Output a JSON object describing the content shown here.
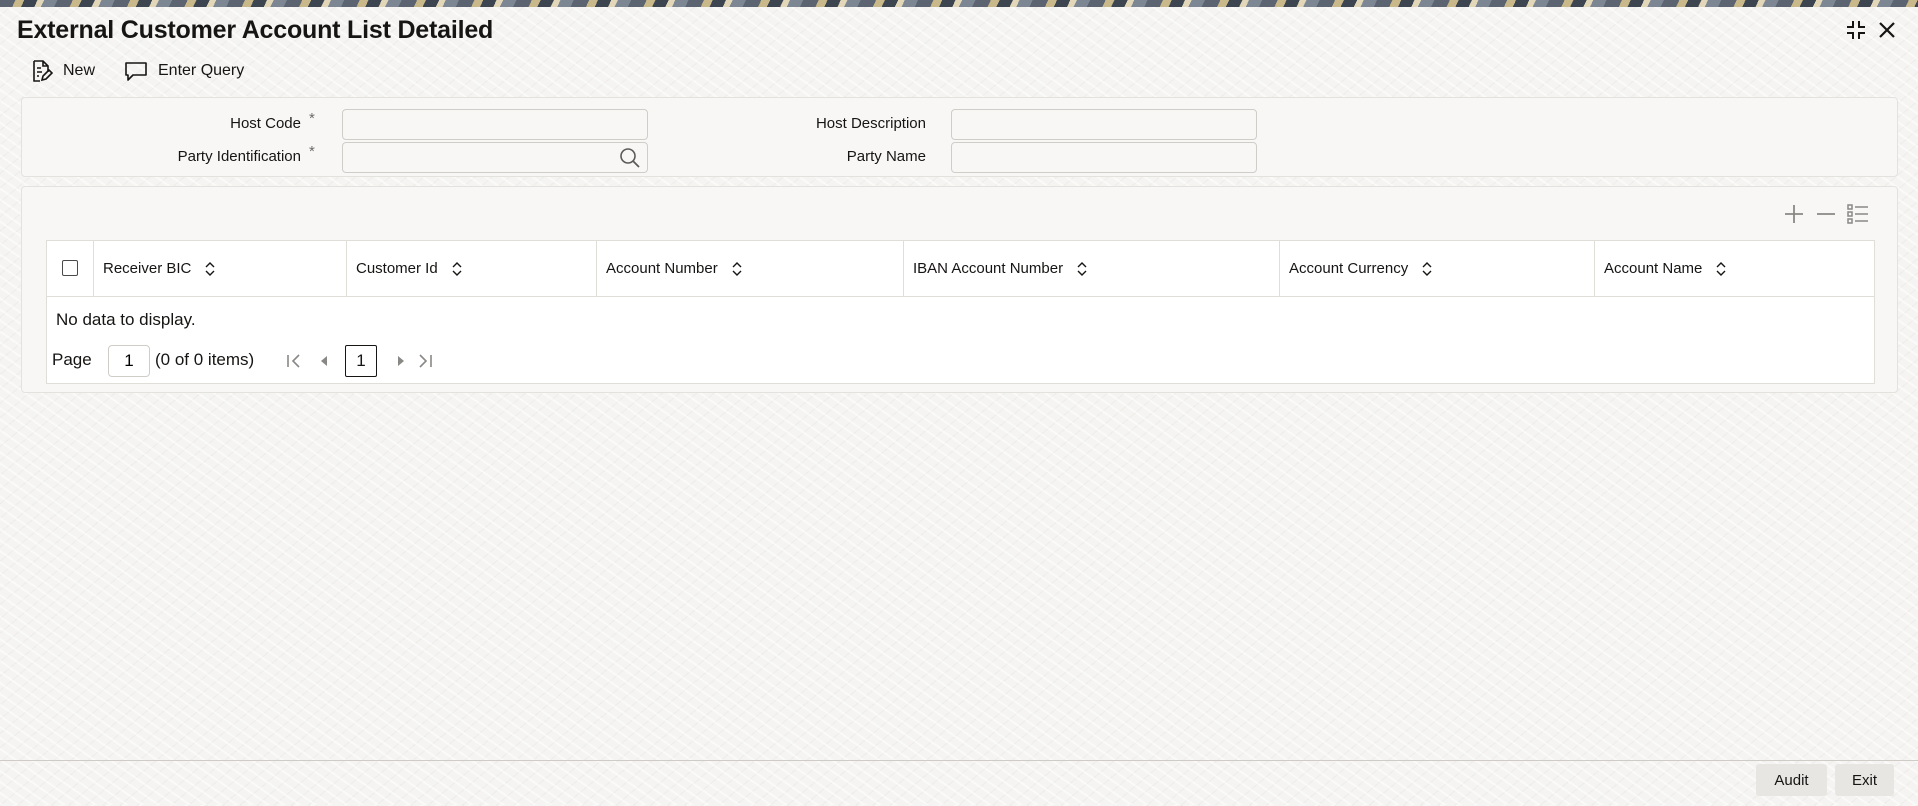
{
  "window": {
    "title": "External Customer Account List Detailed"
  },
  "toolbar": {
    "new_label": "New",
    "enter_query_label": "Enter Query"
  },
  "form": {
    "host_code_label": "Host Code",
    "host_code_value": "",
    "host_description_label": "Host Description",
    "host_description_value": "",
    "party_identification_label": "Party Identification",
    "party_identification_value": "",
    "party_name_label": "Party Name",
    "party_name_value": "",
    "required_marker": "*"
  },
  "table": {
    "columns": [
      "Receiver BIC",
      "Customer Id",
      "Account Number",
      "IBAN Account Number",
      "Account Currency",
      "Account Name"
    ],
    "empty_message": "No data to display."
  },
  "pagination": {
    "page_label": "Page",
    "page_value": "1",
    "items_summary": "(0 of 0 items)",
    "current_page": "1"
  },
  "footer": {
    "audit_label": "Audit",
    "exit_label": "Exit"
  }
}
